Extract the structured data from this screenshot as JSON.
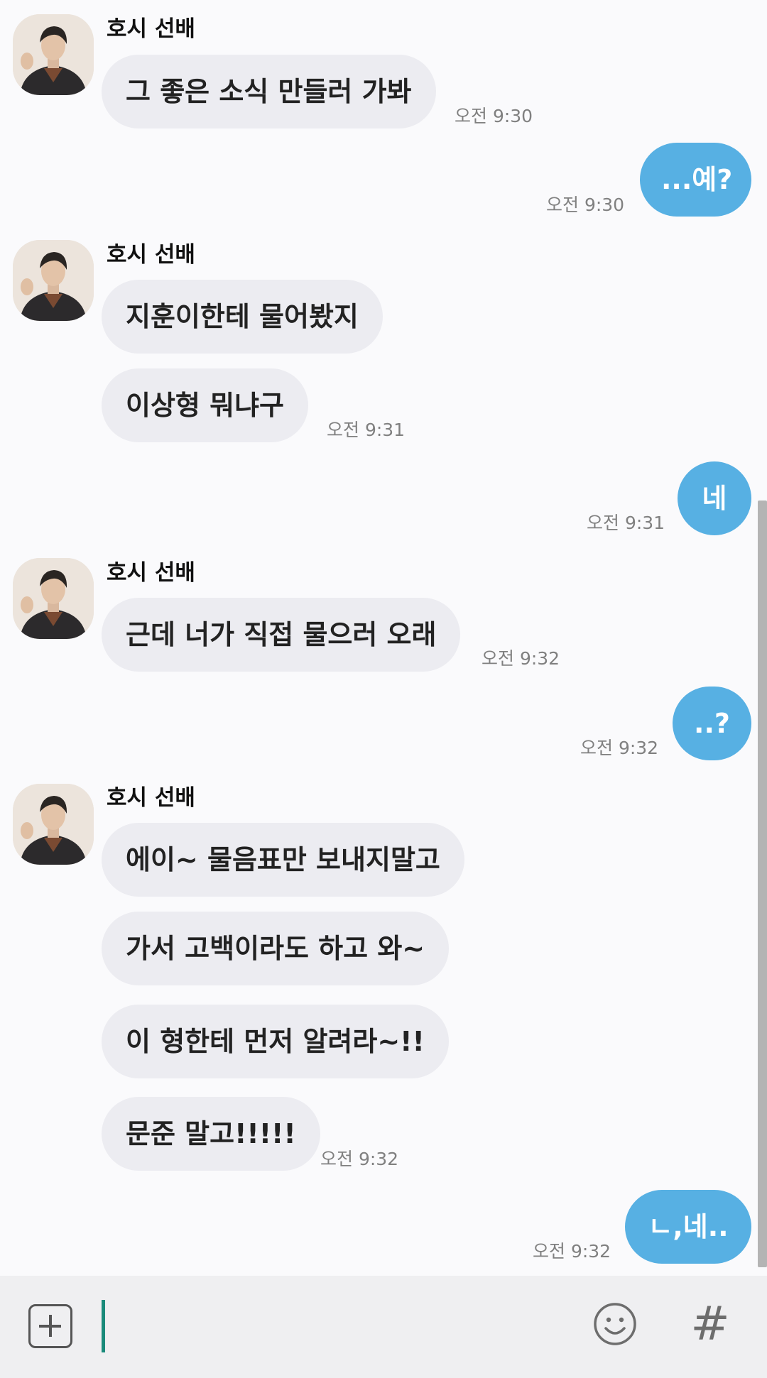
{
  "sender_name": "호시 선배",
  "groups": [
    {
      "side": "in",
      "messages": [
        "그 좋은 소식 만들러 가봐"
      ],
      "time": "오전 9:30"
    },
    {
      "side": "out",
      "messages": [
        "...예?"
      ],
      "time": "오전 9:30"
    },
    {
      "side": "in",
      "messages": [
        "지훈이한테 물어봤지",
        "이상형 뭐냐구"
      ],
      "time": "오전 9:31"
    },
    {
      "side": "out",
      "messages": [
        "네"
      ],
      "time": "오전 9:31"
    },
    {
      "side": "in",
      "messages": [
        "근데 너가 직접 물으러 오래"
      ],
      "time": "오전 9:32"
    },
    {
      "side": "out",
      "messages": [
        "..?"
      ],
      "time": "오전 9:32"
    },
    {
      "side": "in",
      "messages": [
        "에이~ 물음표만 보내지말고",
        "가서 고백이라도 하고 와~",
        "이 형한테 먼저 알려라~!!",
        "문준 말고!!!!!"
      ],
      "time": "오전 9:32"
    },
    {
      "side": "out",
      "messages": [
        "ㄴ,네.."
      ],
      "time": "오전 9:32"
    }
  ],
  "input_bar": {
    "add_icon": "plus-square-icon",
    "message_value": "",
    "emoji_icon": "smiley-icon",
    "hashtag_label": "#"
  },
  "colors": {
    "outgoing_bubble": "#57b0e3",
    "incoming_bubble": "#ececf1",
    "background": "#fafafc",
    "input_bar": "#efeff1",
    "cursor": "#1a8a7a"
  }
}
